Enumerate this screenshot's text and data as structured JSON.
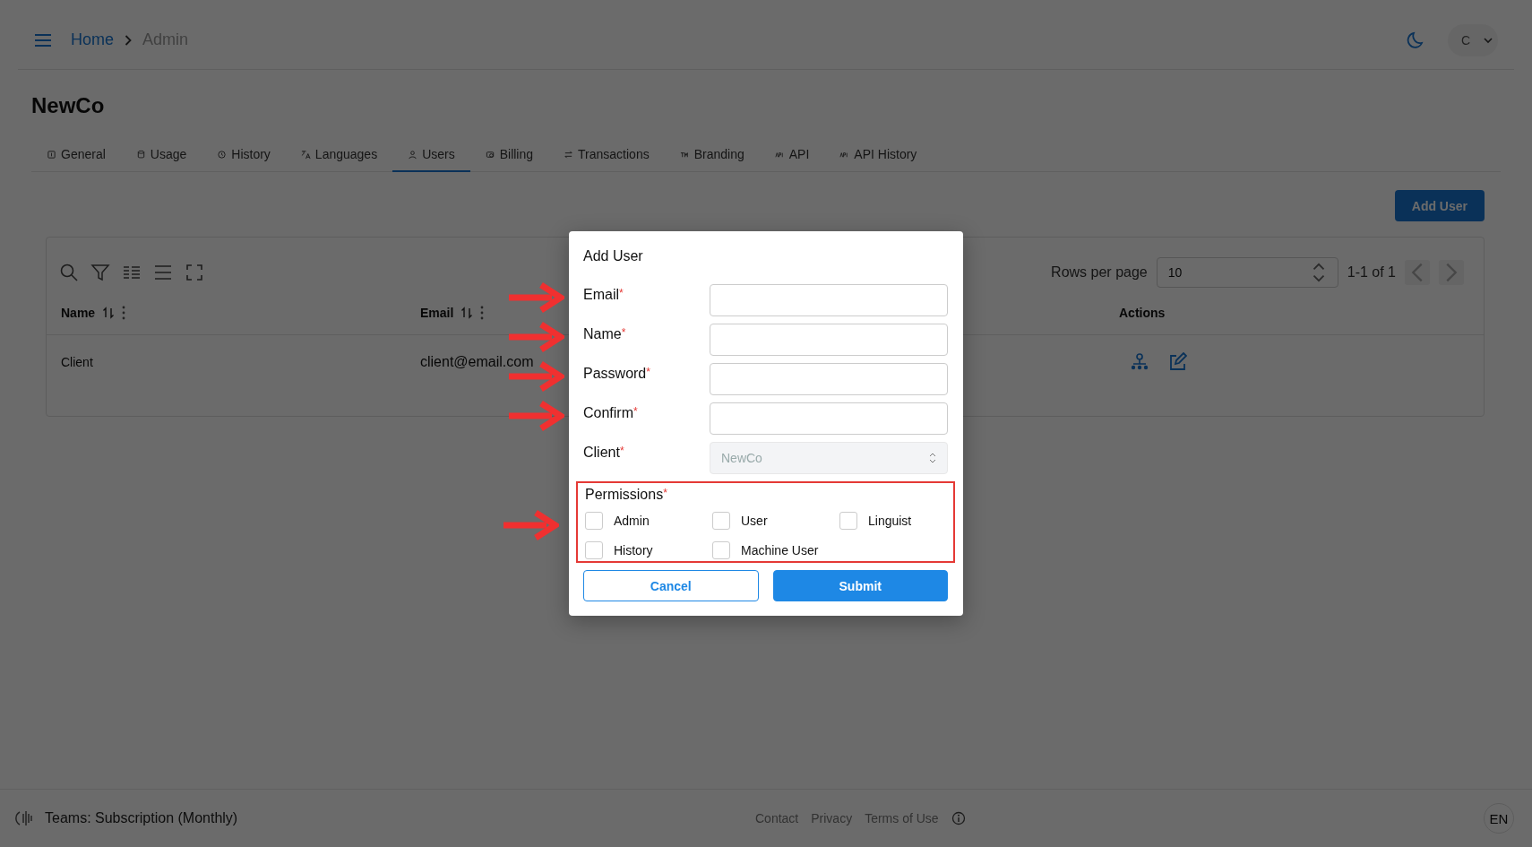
{
  "header": {
    "breadcrumbs": [
      {
        "label": "Home",
        "current": false
      },
      {
        "label": "Admin",
        "current": true
      }
    ],
    "avatar": "C"
  },
  "page_title": "NewCo",
  "tabs": [
    {
      "label": "General",
      "selected": false
    },
    {
      "label": "Usage",
      "selected": false
    },
    {
      "label": "History",
      "selected": false
    },
    {
      "label": "Languages",
      "selected": false
    },
    {
      "label": "Users",
      "selected": true
    },
    {
      "label": "Billing",
      "selected": false
    },
    {
      "label": "Transactions",
      "selected": false
    },
    {
      "label": "Branding",
      "selected": false
    },
    {
      "label": "API",
      "selected": false
    },
    {
      "label": "API History",
      "selected": false
    }
  ],
  "add_button": "Add User",
  "table": {
    "pagination": {
      "rows_label": "Rows per page",
      "rows_value": "10",
      "range": "1-1 of 1"
    },
    "columns": [
      {
        "label": "Name",
        "sortable": true
      },
      {
        "label": "Email",
        "sortable": true
      },
      {
        "label": "Actions",
        "sortable": false
      }
    ],
    "rows": [
      {
        "name": "Client",
        "email": "client@email.com"
      }
    ]
  },
  "dialog": {
    "title": "Add User",
    "fields": [
      {
        "label": "Email",
        "asterisk": "*",
        "kind": "text",
        "marked": true
      },
      {
        "label": "Name",
        "asterisk": "*",
        "kind": "text",
        "marked": true
      },
      {
        "label": "Password",
        "asterisk": "*",
        "kind": "text",
        "marked": true
      },
      {
        "label": "Confirm",
        "asterisk": "*",
        "kind": "text",
        "marked": true
      },
      {
        "label": "Client",
        "asterisk": "*",
        "kind": "select",
        "value": "NewCo",
        "disabled": true,
        "marked": false
      }
    ],
    "permissions": {
      "label": "Permissions",
      "asterisk": "*",
      "marked": true,
      "highlighted": true,
      "options": [
        {
          "label": "Admin",
          "checked": false
        },
        {
          "label": "User",
          "checked": false
        },
        {
          "label": "Linguist",
          "checked": false
        },
        {
          "label": "History",
          "checked": false
        },
        {
          "label": "Machine User",
          "checked": false
        }
      ]
    },
    "buttons": [
      {
        "label": "Cancel",
        "kind": "outline"
      },
      {
        "label": "Submit",
        "kind": "primary"
      }
    ]
  },
  "footer": {
    "plan": "Teams: Subscription (Monthly)",
    "links": [
      "Contact",
      "Privacy",
      "Terms of Use"
    ],
    "language": "EN"
  }
}
